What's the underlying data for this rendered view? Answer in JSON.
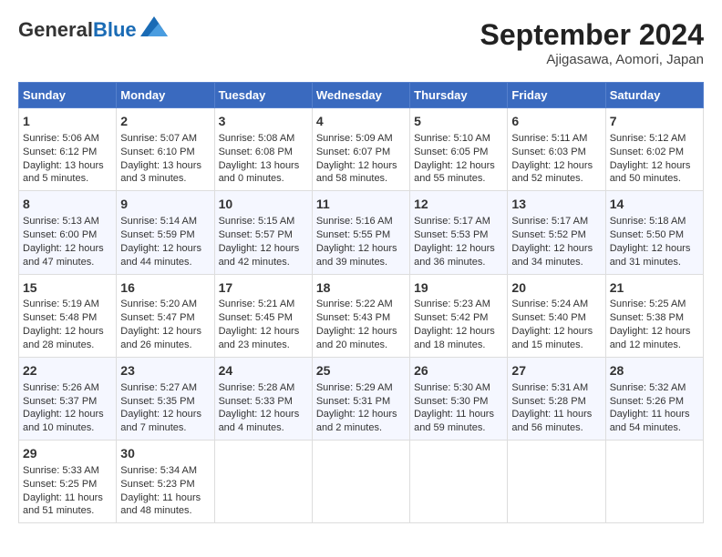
{
  "header": {
    "logo_general": "General",
    "logo_blue": "Blue",
    "title": "September 2024",
    "subtitle": "Ajigasawa, Aomori, Japan"
  },
  "columns": [
    "Sunday",
    "Monday",
    "Tuesday",
    "Wednesday",
    "Thursday",
    "Friday",
    "Saturday"
  ],
  "weeks": [
    [
      {
        "day": "1",
        "lines": [
          "Sunrise: 5:06 AM",
          "Sunset: 6:12 PM",
          "Daylight: 13 hours",
          "and 5 minutes."
        ]
      },
      {
        "day": "2",
        "lines": [
          "Sunrise: 5:07 AM",
          "Sunset: 6:10 PM",
          "Daylight: 13 hours",
          "and 3 minutes."
        ]
      },
      {
        "day": "3",
        "lines": [
          "Sunrise: 5:08 AM",
          "Sunset: 6:08 PM",
          "Daylight: 13 hours",
          "and 0 minutes."
        ]
      },
      {
        "day": "4",
        "lines": [
          "Sunrise: 5:09 AM",
          "Sunset: 6:07 PM",
          "Daylight: 12 hours",
          "and 58 minutes."
        ]
      },
      {
        "day": "5",
        "lines": [
          "Sunrise: 5:10 AM",
          "Sunset: 6:05 PM",
          "Daylight: 12 hours",
          "and 55 minutes."
        ]
      },
      {
        "day": "6",
        "lines": [
          "Sunrise: 5:11 AM",
          "Sunset: 6:03 PM",
          "Daylight: 12 hours",
          "and 52 minutes."
        ]
      },
      {
        "day": "7",
        "lines": [
          "Sunrise: 5:12 AM",
          "Sunset: 6:02 PM",
          "Daylight: 12 hours",
          "and 50 minutes."
        ]
      }
    ],
    [
      {
        "day": "8",
        "lines": [
          "Sunrise: 5:13 AM",
          "Sunset: 6:00 PM",
          "Daylight: 12 hours",
          "and 47 minutes."
        ]
      },
      {
        "day": "9",
        "lines": [
          "Sunrise: 5:14 AM",
          "Sunset: 5:59 PM",
          "Daylight: 12 hours",
          "and 44 minutes."
        ]
      },
      {
        "day": "10",
        "lines": [
          "Sunrise: 5:15 AM",
          "Sunset: 5:57 PM",
          "Daylight: 12 hours",
          "and 42 minutes."
        ]
      },
      {
        "day": "11",
        "lines": [
          "Sunrise: 5:16 AM",
          "Sunset: 5:55 PM",
          "Daylight: 12 hours",
          "and 39 minutes."
        ]
      },
      {
        "day": "12",
        "lines": [
          "Sunrise: 5:17 AM",
          "Sunset: 5:53 PM",
          "Daylight: 12 hours",
          "and 36 minutes."
        ]
      },
      {
        "day": "13",
        "lines": [
          "Sunrise: 5:17 AM",
          "Sunset: 5:52 PM",
          "Daylight: 12 hours",
          "and 34 minutes."
        ]
      },
      {
        "day": "14",
        "lines": [
          "Sunrise: 5:18 AM",
          "Sunset: 5:50 PM",
          "Daylight: 12 hours",
          "and 31 minutes."
        ]
      }
    ],
    [
      {
        "day": "15",
        "lines": [
          "Sunrise: 5:19 AM",
          "Sunset: 5:48 PM",
          "Daylight: 12 hours",
          "and 28 minutes."
        ]
      },
      {
        "day": "16",
        "lines": [
          "Sunrise: 5:20 AM",
          "Sunset: 5:47 PM",
          "Daylight: 12 hours",
          "and 26 minutes."
        ]
      },
      {
        "day": "17",
        "lines": [
          "Sunrise: 5:21 AM",
          "Sunset: 5:45 PM",
          "Daylight: 12 hours",
          "and 23 minutes."
        ]
      },
      {
        "day": "18",
        "lines": [
          "Sunrise: 5:22 AM",
          "Sunset: 5:43 PM",
          "Daylight: 12 hours",
          "and 20 minutes."
        ]
      },
      {
        "day": "19",
        "lines": [
          "Sunrise: 5:23 AM",
          "Sunset: 5:42 PM",
          "Daylight: 12 hours",
          "and 18 minutes."
        ]
      },
      {
        "day": "20",
        "lines": [
          "Sunrise: 5:24 AM",
          "Sunset: 5:40 PM",
          "Daylight: 12 hours",
          "and 15 minutes."
        ]
      },
      {
        "day": "21",
        "lines": [
          "Sunrise: 5:25 AM",
          "Sunset: 5:38 PM",
          "Daylight: 12 hours",
          "and 12 minutes."
        ]
      }
    ],
    [
      {
        "day": "22",
        "lines": [
          "Sunrise: 5:26 AM",
          "Sunset: 5:37 PM",
          "Daylight: 12 hours",
          "and 10 minutes."
        ]
      },
      {
        "day": "23",
        "lines": [
          "Sunrise: 5:27 AM",
          "Sunset: 5:35 PM",
          "Daylight: 12 hours",
          "and 7 minutes."
        ]
      },
      {
        "day": "24",
        "lines": [
          "Sunrise: 5:28 AM",
          "Sunset: 5:33 PM",
          "Daylight: 12 hours",
          "and 4 minutes."
        ]
      },
      {
        "day": "25",
        "lines": [
          "Sunrise: 5:29 AM",
          "Sunset: 5:31 PM",
          "Daylight: 12 hours",
          "and 2 minutes."
        ]
      },
      {
        "day": "26",
        "lines": [
          "Sunrise: 5:30 AM",
          "Sunset: 5:30 PM",
          "Daylight: 11 hours",
          "and 59 minutes."
        ]
      },
      {
        "day": "27",
        "lines": [
          "Sunrise: 5:31 AM",
          "Sunset: 5:28 PM",
          "Daylight: 11 hours",
          "and 56 minutes."
        ]
      },
      {
        "day": "28",
        "lines": [
          "Sunrise: 5:32 AM",
          "Sunset: 5:26 PM",
          "Daylight: 11 hours",
          "and 54 minutes."
        ]
      }
    ],
    [
      {
        "day": "29",
        "lines": [
          "Sunrise: 5:33 AM",
          "Sunset: 5:25 PM",
          "Daylight: 11 hours",
          "and 51 minutes."
        ]
      },
      {
        "day": "30",
        "lines": [
          "Sunrise: 5:34 AM",
          "Sunset: 5:23 PM",
          "Daylight: 11 hours",
          "and 48 minutes."
        ]
      },
      {
        "day": "",
        "lines": []
      },
      {
        "day": "",
        "lines": []
      },
      {
        "day": "",
        "lines": []
      },
      {
        "day": "",
        "lines": []
      },
      {
        "day": "",
        "lines": []
      }
    ]
  ]
}
